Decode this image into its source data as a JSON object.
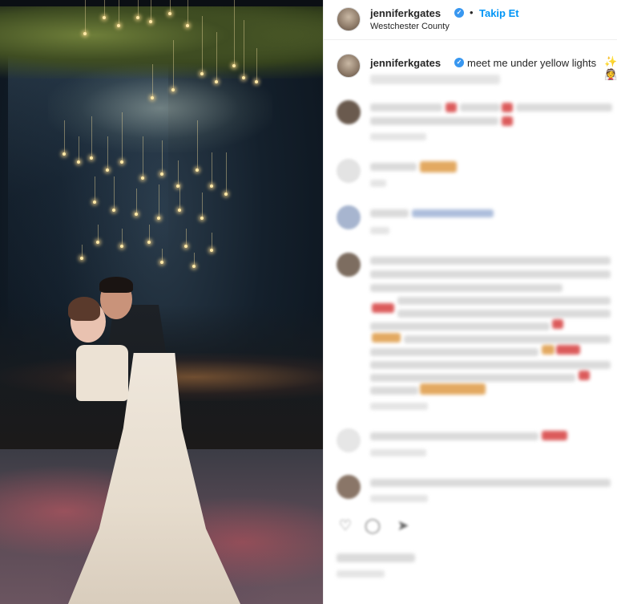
{
  "post": {
    "username": "jenniferkgates",
    "follow_label": "Takip Et",
    "separator": "•",
    "location": "Westchester County",
    "caption_user": "jenniferkgates",
    "caption_text": "meet me under yellow lights",
    "caption_emoji": "✨👰"
  },
  "colors": {
    "accent": "#0095f6",
    "verified": "#3897f0",
    "text": "#262626"
  },
  "icons": {
    "verified": "verified-badge-icon",
    "like": "heart-icon",
    "comment": "comment-icon",
    "share": "share-icon"
  }
}
